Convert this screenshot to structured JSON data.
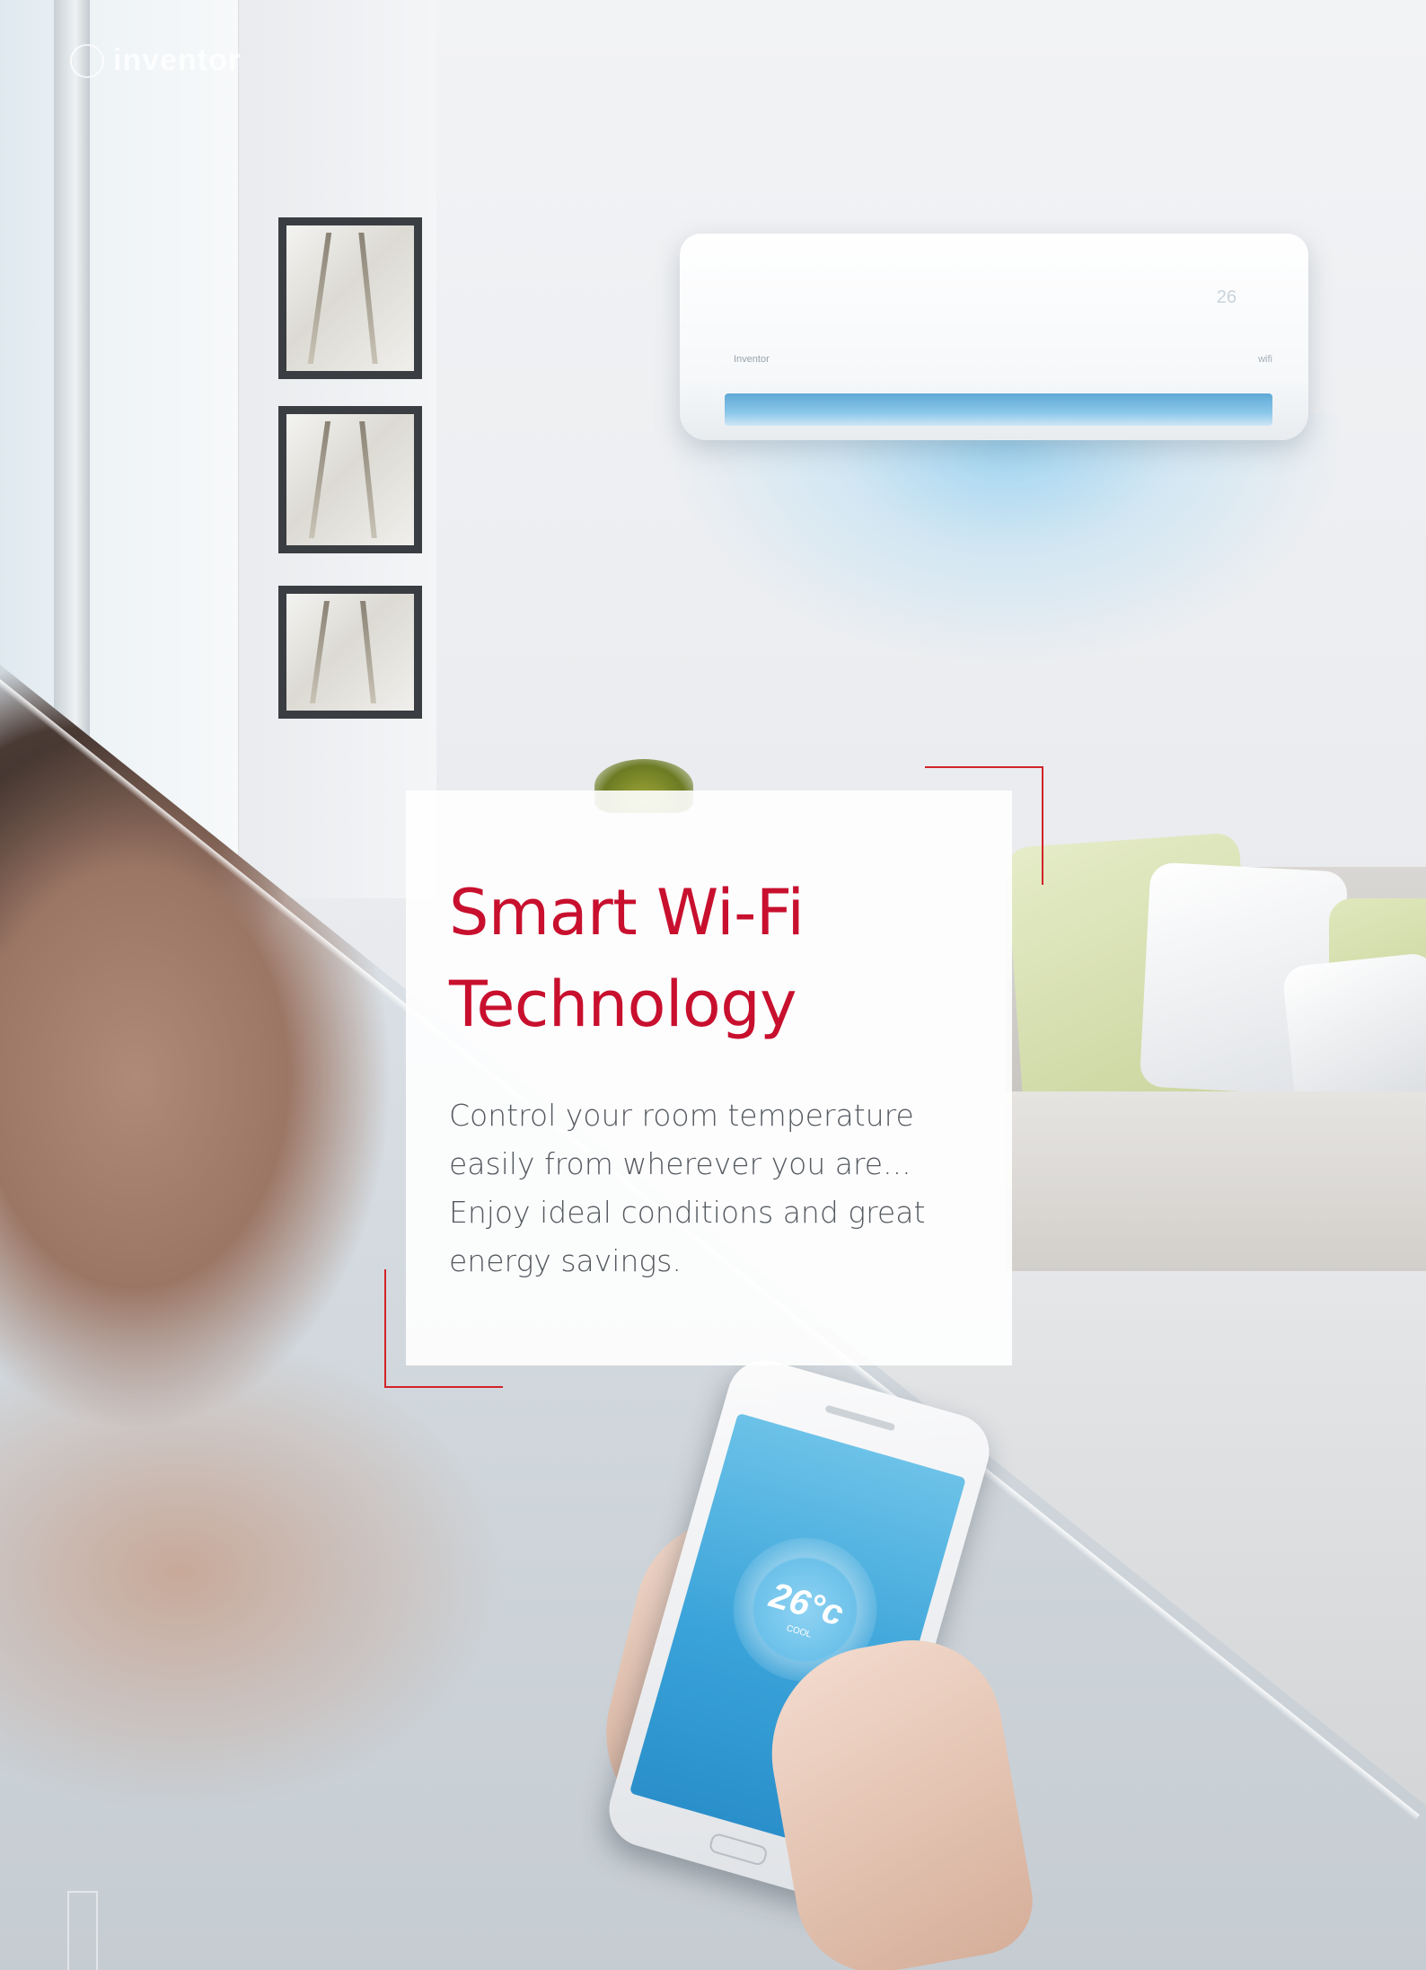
{
  "brand": {
    "logo_text": "inventor"
  },
  "headline": {
    "line1": "Smart Wi-Fi",
    "line2": "Technology"
  },
  "description": "Control your room temperature easily from wherever you are... Enjoy ideal conditions and great energy savings.",
  "phone_app": {
    "temperature": "26°c",
    "mode": "COOL"
  },
  "ac_unit": {
    "brand_label": "Inventor",
    "display": "26"
  },
  "colors": {
    "accent": "#c8102e",
    "body_text": "#555a60",
    "screen_blue": "#3aa3d9"
  }
}
